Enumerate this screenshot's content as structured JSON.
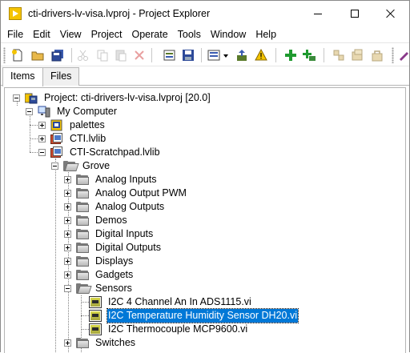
{
  "window": {
    "title": "cti-drivers-lv-visa.lvproj - Project Explorer"
  },
  "menu": [
    "File",
    "Edit",
    "View",
    "Project",
    "Operate",
    "Tools",
    "Window",
    "Help"
  ],
  "tabs": {
    "items": "Items",
    "files": "Files"
  },
  "tree": {
    "project": "Project: cti-drivers-lv-visa.lvproj [20.0]",
    "my_computer": "My Computer",
    "palettes": "palettes",
    "cti_lib": "CTI.lvlib",
    "scratchpad": "CTI-Scratchpad.lvlib",
    "grove": "Grove",
    "folders": [
      "Analog Inputs",
      "Analog Output PWM",
      "Analog Outputs",
      "Demos",
      "Digital Inputs",
      "Digital Outputs",
      "Displays",
      "Gadgets"
    ],
    "sensors": "Sensors",
    "vis": [
      "I2C 4 Channel An In ADS1115.vi",
      "I2C Temperature Humidity Sensor DH20.vi",
      "I2C Thermocouple MCP9600.vi"
    ],
    "switches": "Switches"
  },
  "colors": {
    "selection": "#0078d7",
    "title_icon": "#f5c400"
  }
}
